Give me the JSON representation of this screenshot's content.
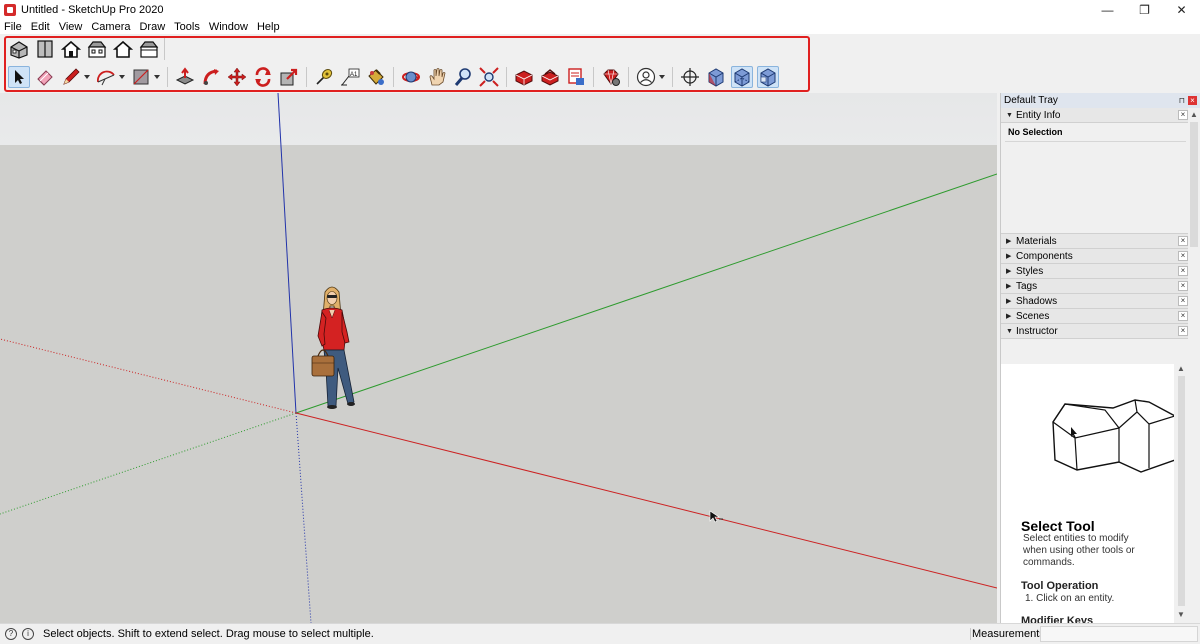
{
  "window": {
    "title": "Untitled - SketchUp Pro 2020",
    "minimize": "—",
    "restore": "❐",
    "close": "✕"
  },
  "menu": [
    "File",
    "Edit",
    "View",
    "Camera",
    "Draw",
    "Tools",
    "Window",
    "Help"
  ],
  "toolbar": {
    "row1_icons": [
      "iso-view-icon",
      "top-view-icon",
      "front-view-icon",
      "right-view-icon",
      "back-view-icon",
      "left-view-icon"
    ],
    "row2_icons": [
      "select-icon",
      "eraser-icon",
      "pencil-icon",
      "arc-icon",
      "rectangle-icon",
      "push-pull-icon",
      "follow-me-icon",
      "move-icon",
      "rotate-icon",
      "scale-icon",
      "tape-measure-icon",
      "text-icon",
      "paint-bucket-icon",
      "orbit-icon",
      "pan-icon",
      "zoom-icon",
      "zoom-extents-icon",
      "3d-warehouse-icon",
      "extension-warehouse-icon",
      "layout-icon",
      "extension-manager-icon",
      "account-icon",
      "position-camera-icon",
      "x-ray-icon",
      "back-edges-icon",
      "wireframe-icon"
    ],
    "active_tool": "select-icon",
    "colors": {
      "highlight": "#e02020",
      "active_bg": "#cfe3f7"
    }
  },
  "viewport": {
    "colors": {
      "ground": "#cfcfcc",
      "sky": "#e8e9ea",
      "red_axis": "#cc2222",
      "green_axis": "#2e9b2e",
      "blue_axis": "#2233aa"
    }
  },
  "tray": {
    "title": "Default Tray",
    "pin": "⊓",
    "close": "×",
    "entity_info": {
      "label": "Entity Info",
      "value": "No Selection"
    },
    "panels": [
      "Materials",
      "Components",
      "Styles",
      "Tags",
      "Shadows",
      "Scenes"
    ],
    "instructor": {
      "label": "Instructor",
      "title": "Select Tool",
      "description": "Select entities to modify when using other tools or commands.",
      "operation_heading": "Tool Operation",
      "operation_step": "1. Click on an entity.",
      "modifier_heading": "Modifier Keys"
    }
  },
  "statusbar": {
    "text": "Select objects. Shift to extend select. Drag mouse to select multiple.",
    "measurements_label": "Measurements",
    "measurements_value": ""
  }
}
